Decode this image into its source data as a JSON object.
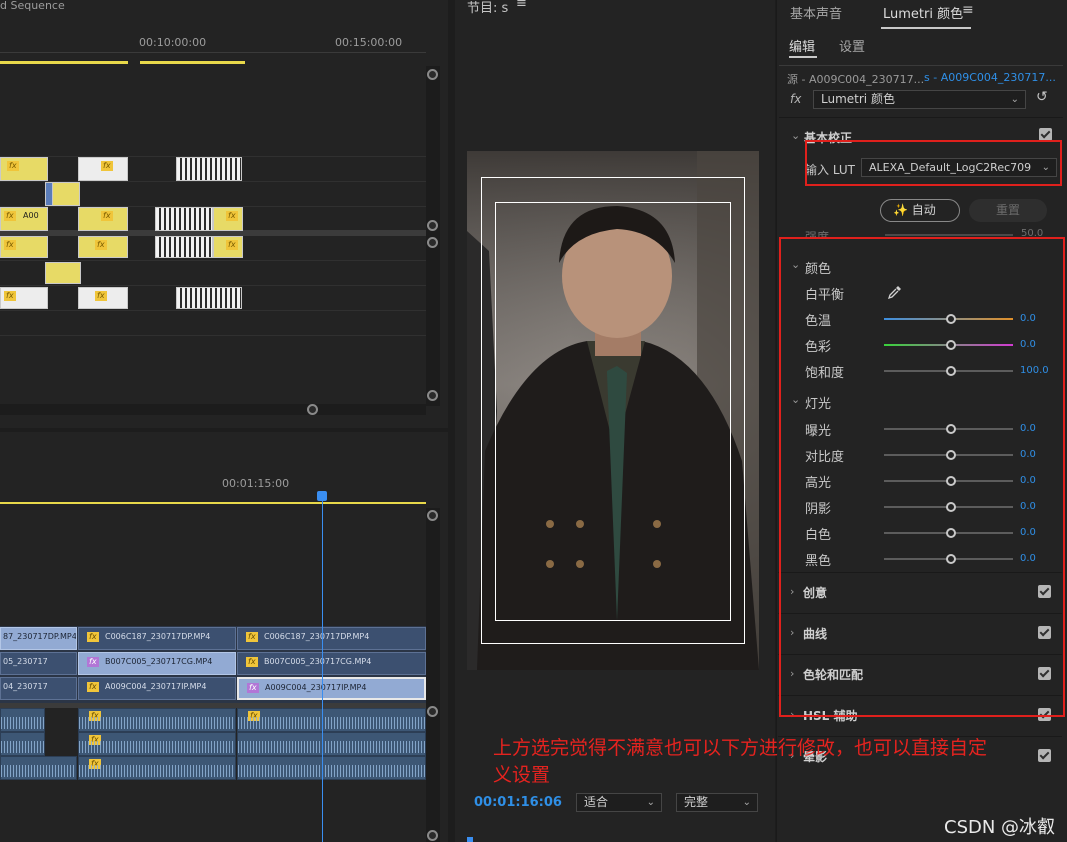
{
  "left_top": {
    "sequence_title": "d Sequence",
    "ruler": [
      "00:10:00:00",
      "00:15:00:00"
    ],
    "clips": {
      "fx": "fx",
      "a00": "A00"
    }
  },
  "left_bottom": {
    "ruler": [
      "00:01:15:00"
    ],
    "video_clips": [
      [
        "87_230717DP.MP4",
        "C006C187_230717DP.MP4",
        "C006C187_230717DP.MP4"
      ],
      [
        "05_230717",
        "B007C005_230717CG.MP4",
        "B007C005_230717CG.MP4"
      ],
      [
        "04_230717",
        "A009C004_230717IP.MP4",
        "A009C004_230717IP.MP4"
      ]
    ],
    "fx": "fx"
  },
  "monitor": {
    "title": "节目: s",
    "menu_icon": "hamburger-icon",
    "timecode": "00:01:16:06",
    "zoom_select": "适合",
    "quality_select": "完整"
  },
  "lumetri": {
    "tabs": [
      "基本声音",
      "Lumetri 颜色"
    ],
    "menu_icon": "hamburger-icon",
    "subtabs": [
      "编辑",
      "设置"
    ],
    "source": "源 - A009C004_230717...",
    "sequence_clip": "s - A009C004_230717...",
    "fx_label": "fx",
    "effect_select": "Lumetri 颜色",
    "basic_section": "基本校正",
    "lut_label": "输入 LUT",
    "lut_value": "ALEXA_Default_LogC2Rec709",
    "auto_button": "自动",
    "reset_button": "重置",
    "intensity_label": "强度",
    "intensity_value": "50.0",
    "color_group": "颜色",
    "white_balance": "白平衡",
    "light_group": "灯光",
    "params": [
      {
        "label": "色温",
        "value": "0.0"
      },
      {
        "label": "色彩",
        "value": "0.0"
      },
      {
        "label": "饱和度",
        "value": "100.0"
      },
      {
        "label": "曝光",
        "value": "0.0"
      },
      {
        "label": "对比度",
        "value": "0.0"
      },
      {
        "label": "高光",
        "value": "0.0"
      },
      {
        "label": "阴影",
        "value": "0.0"
      },
      {
        "label": "白色",
        "value": "0.0"
      },
      {
        "label": "黑色",
        "value": "0.0"
      }
    ],
    "sections": [
      "创意",
      "曲线",
      "色轮和匹配",
      "HSL 辅助",
      "晕影"
    ],
    "colors": {
      "temp_gradient": [
        "#3d8fe0",
        "#e0902a"
      ],
      "tint_gradient": [
        "#39d23b",
        "#d23bd2"
      ],
      "value_blue": "#2f8fe6"
    }
  },
  "annotation": {
    "note": "上方选完觉得不满意也可以下方进行修改，也可以直接自定义设置",
    "watermark": "CSDN @冰叡",
    "color": "#e0201c"
  }
}
